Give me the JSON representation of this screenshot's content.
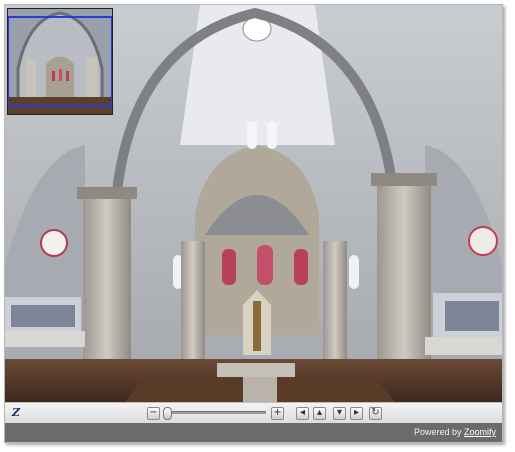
{
  "viewer": {
    "navigator": {
      "label": "navigator-thumbnail"
    },
    "toolbar": {
      "logo": "Z",
      "buttons": [
        {
          "name": "zoom-out",
          "glyph": "−"
        },
        {
          "name": "zoom-in",
          "glyph": "+"
        },
        {
          "name": "pan-left",
          "glyph": "◂"
        },
        {
          "name": "pan-up",
          "glyph": "▴"
        },
        {
          "name": "pan-down",
          "glyph": "▾"
        },
        {
          "name": "pan-right",
          "glyph": "▸"
        },
        {
          "name": "reset",
          "glyph": "↻"
        }
      ],
      "zoom_level": 0.05
    },
    "footer": {
      "powered_prefix": "Powered by",
      "powered_brand": "Zoomify"
    }
  }
}
